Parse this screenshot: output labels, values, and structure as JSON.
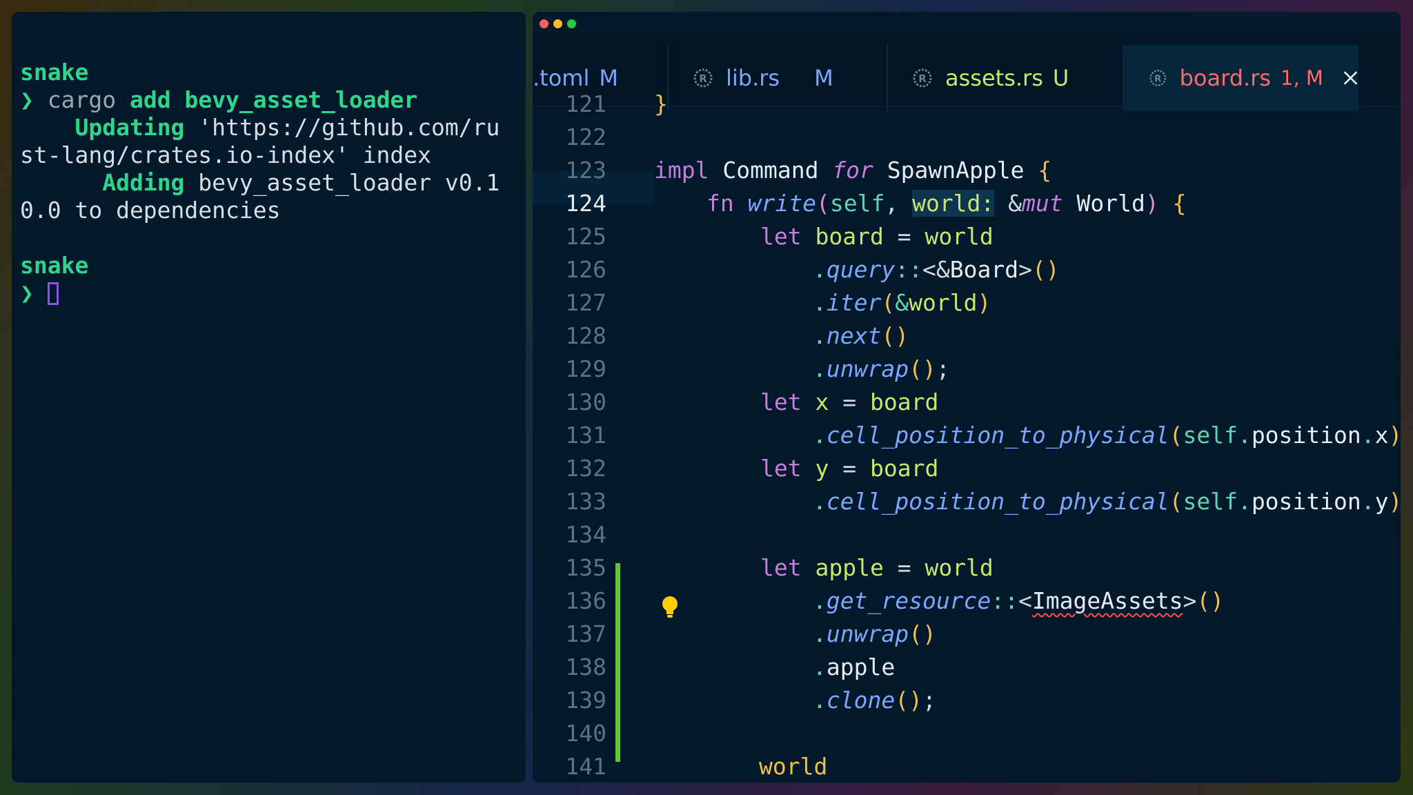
{
  "terminal": {
    "dir1": "snake",
    "prompt_symbol": "❯",
    "cmd_cargo": "cargo",
    "cmd_add": "add",
    "cmd_crate": "bevy_asset_loader",
    "updating_label": "Updating",
    "updating_text_1": " 'https://github.com/ru",
    "updating_text_2": "st-lang/crates.io-index' index",
    "adding_label": "Adding",
    "adding_text_1": " bevy_asset_loader v0.1",
    "adding_text_2": "0.0 to dependencies",
    "dir2": "snake"
  },
  "editor": {
    "tabs": [
      {
        "label": ".toml",
        "status": "M"
      },
      {
        "label": "lib.rs",
        "status": "M"
      },
      {
        "label": "assets.rs",
        "status": "U"
      },
      {
        "label": "board.rs",
        "status": "1, M",
        "active": true
      }
    ],
    "line_numbers": [
      "121",
      "122",
      "123",
      "124",
      "125",
      "126",
      "127",
      "128",
      "129",
      "130",
      "131",
      "132",
      "133",
      "134",
      "135",
      "136",
      "137",
      "138",
      "139",
      "140",
      "141"
    ],
    "active_line": "124",
    "code": {
      "l121": "}",
      "l123_impl": "impl",
      "l123_cmd": "Command",
      "l123_for": "for",
      "l123_type": "SpawnApple",
      "l123_brace": "{",
      "l124_fn": "fn",
      "l124_name": "write",
      "l124_self": "self",
      "l124_world": "world",
      "l124_mut": "mut",
      "l124_type": "World",
      "l125_let": "let",
      "l125_var": "board",
      "l125_world": "world",
      "l126_fn": "query",
      "l126_type": "Board",
      "l127_fn": "iter",
      "l127_arg": "world",
      "l128_fn": "next",
      "l129_fn": "unwrap",
      "l130_let": "let",
      "l130_var": "x",
      "l130_board": "board",
      "l131_fn": "cell_position_to_physical",
      "l131_self": "self",
      "l131_pos": "position",
      "l131_axis": "x",
      "l132_let": "let",
      "l132_var": "y",
      "l132_board": "board",
      "l133_fn": "cell_position_to_physical",
      "l133_self": "self",
      "l133_pos": "position",
      "l133_axis": "y",
      "l135_let": "let",
      "l135_var": "apple",
      "l135_world": "world",
      "l136_fn": "get_resource",
      "l136_type": "ImageAssets",
      "l137_fn": "unwrap",
      "l138_field": "apple",
      "l139_fn": "clone",
      "l141_world": "world"
    }
  },
  "colors": {
    "terminal_bg": "#02192b",
    "accent_green": "#2fd58c",
    "tab_modified": "#7aa7ff",
    "tab_untracked": "#c7e86b",
    "tab_active_error": "#ff6b6b",
    "gutter_added": "#6ac23c"
  },
  "icons": [
    "rust-file-icon",
    "close-icon",
    "lightbulb-icon",
    "traffic-light-icons"
  ]
}
